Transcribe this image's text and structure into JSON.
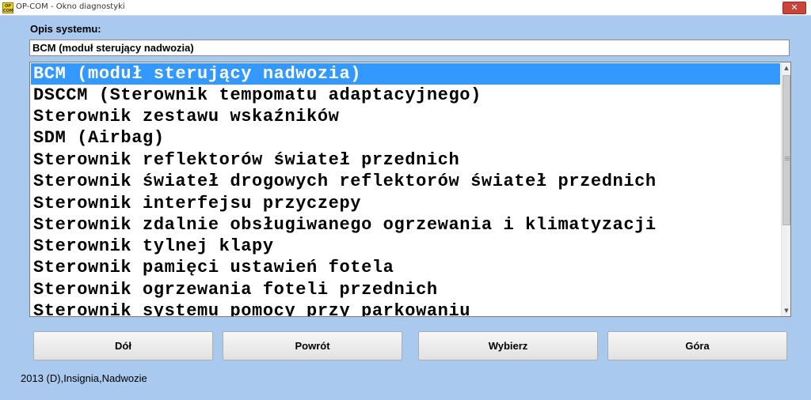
{
  "window": {
    "icon_text": "OP COM",
    "title": "OP-COM - Okno diagnostyki",
    "close_label": "✕"
  },
  "opis": {
    "label": "Opis systemu:",
    "value": "BCM (moduł sterujący nadwozia)"
  },
  "list": {
    "selected_index": 0,
    "items": [
      "BCM (moduł sterujący nadwozia)",
      "DSCCM (Sterownik tempomatu adaptacyjnego)",
      "Sterownik zestawu wskaźników",
      "SDM (Airbag)",
      "Sterownik reflektorów świateł przednich",
      "Sterownik świateł drogowych reflektorów świateł przednich",
      "Sterownik interfejsu przyczepy",
      "Sterownik zdalnie obsługiwanego ogrzewania i klimatyzacji",
      "Sterownik tylnej klapy",
      "Sterownik pamięci ustawień fotela",
      "Sterownik ogrzewania foteli przednich",
      "Sterownik systemu pomocy przy parkowaniu"
    ],
    "scroll_up_icon": "▲",
    "scroll_down_icon": "▼"
  },
  "buttons": {
    "dol": "Dół",
    "powrot": "Powrót",
    "wybierz": "Wybierz",
    "gora": "Góra"
  },
  "status": "2013 (D),Insignia,Nadwozie",
  "colors": {
    "background": "#a9c9ee",
    "selection": "#3399ff"
  }
}
